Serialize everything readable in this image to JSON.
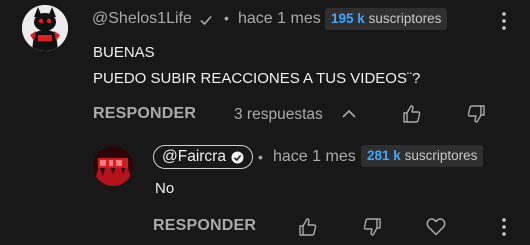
{
  "comment": {
    "author": "@Shelos1Life",
    "time": "hace 1 mes",
    "subs_count": "195 k",
    "subs_label": "suscriptores",
    "lines": [
      "BUENAS",
      "PUEDO SUBIR REACCIONES A TUS VIDEOS¨?"
    ],
    "reply_label": "RESPONDER",
    "replies_label": "3 respuestas"
  },
  "reply": {
    "author": "@Faircra",
    "time": "hace 1 mes",
    "subs_count": "281 k",
    "subs_label": "suscriptores",
    "text": "No",
    "reply_label": "RESPONDER"
  },
  "icons": {
    "verified": "checkmark-icon",
    "verified_reply": "check-circle-icon",
    "expand": "chevron-up-icon",
    "like": "thumbs-up-icon",
    "dislike": "thumbs-down-icon",
    "heart": "heart-icon",
    "more": "more-vertical-icon"
  },
  "colors": {
    "background": "#181818",
    "accent_blue": "#3ea6ff",
    "muted": "#aaaaaa"
  }
}
